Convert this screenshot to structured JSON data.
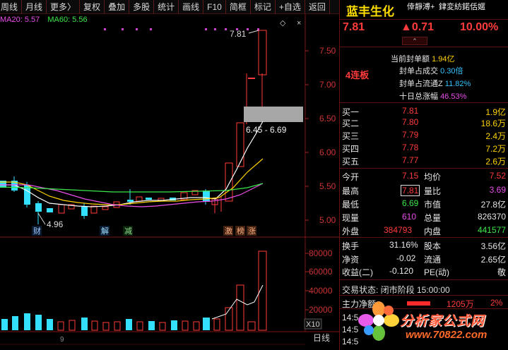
{
  "toolbar": [
    "周线",
    "月线",
    "更多〉",
    "复权",
    "叠加",
    "多股",
    "统计",
    "画线",
    "F10",
    "简框",
    "标记",
    "+自选",
    "返回"
  ],
  "ma_legend": {
    "ma20": "MA20: 5.57",
    "ma60": "MA60: 5.56"
  },
  "price_axis": [
    "7.50",
    "7.00",
    "6.50",
    "6.00",
    "5.50",
    "5.00"
  ],
  "vol_axis": [
    "80000",
    "60000",
    "40000",
    "20000"
  ],
  "vol_unit": "X10",
  "date_label": "日线",
  "chart_annotations": {
    "high": "7.81",
    "low": "4.96",
    "gap": "6.45 - 6.69",
    "events": [
      "财",
      "解",
      "减",
      "激",
      "榜",
      "涨"
    ],
    "bottom_digit": "9"
  },
  "stock": {
    "name": "蓝丰生化",
    "sub_line1": "倖靜溥+",
    "sub_line2": "銉変紡鍩佸嫟",
    "price": "7.81",
    "change": "▲0.71",
    "pct": "10.00%",
    "expand_icon": "chevron-up"
  },
  "limit_info": {
    "streak": "4连板",
    "rows": [
      {
        "label": "当前封单额",
        "value": "1.94亿"
      },
      {
        "label": "封单占成交",
        "value": "0.30倍"
      },
      {
        "label": "封单占流通Z",
        "value": "11.82%"
      },
      {
        "label": "十日总涨幅",
        "value": "46.53%"
      }
    ]
  },
  "order_book": [
    {
      "label": "买一",
      "price": "7.81",
      "vol": "1.9亿"
    },
    {
      "label": "买二",
      "price": "7.80",
      "vol": "18.6万"
    },
    {
      "label": "买三",
      "price": "7.79",
      "vol": "2.4万"
    },
    {
      "label": "买四",
      "price": "7.78",
      "vol": "7.2万"
    },
    {
      "label": "买五",
      "price": "7.77",
      "vol": "2.6万"
    }
  ],
  "quote": {
    "open_label": "今开",
    "open": "7.15",
    "avg_label": "均价",
    "avg": "7.52",
    "high_label": "最高",
    "high": "7.81",
    "ratio_label": "量比",
    "ratio": "3.69",
    "low_label": "最低",
    "low": "6.69",
    "mcap_label": "市值",
    "mcap": "27.8亿",
    "vol_label": "现量",
    "vol": "610",
    "total_label": "总量",
    "total": "826370",
    "out_label": "外盘",
    "out": "384793",
    "in_label": "内盘",
    "in": "441577"
  },
  "fundamentals": {
    "turnover_label": "换手",
    "turnover": "31.16%",
    "equity_label": "股本",
    "equity": "3.56亿",
    "nav_label": "净资",
    "nav": "-0.02",
    "float_label": "流通",
    "float": "2.65亿",
    "eps_label": "收益(二)",
    "eps": "-0.120",
    "pe_label": "PE(动)",
    "pe": "敬"
  },
  "trade_status": "交易状态: 闭市阶段 15:00:00",
  "main_flow": {
    "label": "主力净额",
    "amount": "1205万",
    "pct": "2%"
  },
  "ticks": [
    "14:5",
    "14:5",
    "14:5"
  ],
  "watermark": {
    "text": "分析家公式网",
    "url": "www.70822.com"
  },
  "colors": {
    "up": "#ff3b3b",
    "down": "#33e0ff",
    "ma5": "#ffffff",
    "ma10": "#ffd200",
    "ma20": "#e94ee9",
    "ma60": "#3be84a"
  }
}
